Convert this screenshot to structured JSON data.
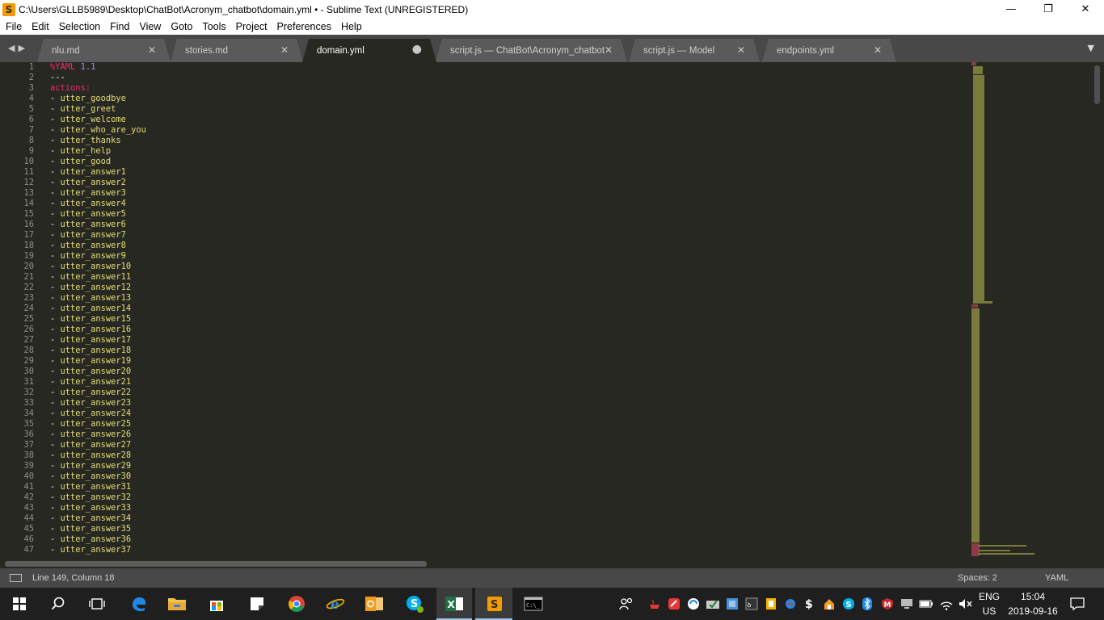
{
  "window": {
    "title": "C:\\Users\\GLLB5989\\Desktop\\ChatBot\\Acronym_chatbot\\domain.yml • - Sublime Text (UNREGISTERED)",
    "app_icon_glyph": "S",
    "minimize": "—",
    "maximize": "❐",
    "close": "✕"
  },
  "menu": [
    "File",
    "Edit",
    "Selection",
    "Find",
    "View",
    "Goto",
    "Tools",
    "Project",
    "Preferences",
    "Help"
  ],
  "tabs": [
    {
      "label": "nlu.md",
      "close": "✕"
    },
    {
      "label": "stories.md",
      "close": "✕"
    },
    {
      "label": "domain.yml",
      "close": "●",
      "active": true
    },
    {
      "label": "script.js — ChatBot\\Acronym_chatbot",
      "close": "✕"
    },
    {
      "label": "script.js — Model",
      "close": "✕"
    },
    {
      "label": "endpoints.yml",
      "close": "✕"
    }
  ],
  "tab_nav": {
    "prev": "◀",
    "next": "▶",
    "dropdown": "▼"
  },
  "editor": {
    "line_numbers": [
      "1",
      "2",
      "3",
      "4",
      "5",
      "6",
      "7",
      "8",
      "9",
      "10",
      "11",
      "12",
      "13",
      "14",
      "15",
      "16",
      "17",
      "18",
      "19",
      "20",
      "21",
      "22",
      "23",
      "24",
      "25",
      "26",
      "27",
      "28",
      "29",
      "30",
      "31",
      "32",
      "33",
      "34",
      "35",
      "36",
      "37",
      "38",
      "39",
      "40",
      "41",
      "42",
      "43",
      "44",
      "45",
      "46",
      "47"
    ],
    "header": {
      "pct": "%",
      "yaml": "YAML",
      "version": "1.1",
      "sep": "---",
      "actions": "actions:"
    },
    "items": [
      "utter_goodbye",
      "utter_greet",
      "utter_welcome",
      "utter_who_are_you",
      "utter_thanks",
      "utter_help",
      "utter_good",
      "utter_answer1",
      "utter_answer2",
      "utter_answer3",
      "utter_answer4",
      "utter_answer5",
      "utter_answer6",
      "utter_answer7",
      "utter_answer8",
      "utter_answer9",
      "utter_answer10",
      "utter_answer11",
      "utter_answer12",
      "utter_answer13",
      "utter_answer14",
      "utter_answer15",
      "utter_answer16",
      "utter_answer17",
      "utter_answer18",
      "utter_answer19",
      "utter_answer20",
      "utter_answer21",
      "utter_answer22",
      "utter_answer23",
      "utter_answer24",
      "utter_answer25",
      "utter_answer26",
      "utter_answer27",
      "utter_answer28",
      "utter_answer29",
      "utter_answer30",
      "utter_answer31",
      "utter_answer32",
      "utter_answer33",
      "utter_answer34",
      "utter_answer35",
      "utter_answer36",
      "utter_answer37"
    ],
    "dash": "-"
  },
  "status": {
    "position": "Line 149, Column 18",
    "spaces": "Spaces: 2",
    "syntax": "YAML"
  },
  "taskbar": {
    "language": "ENG",
    "region": "US",
    "time": "15:04",
    "date": "2019-09-16"
  },
  "colors": {
    "editor_bg": "#272822",
    "string": "#e6db74",
    "keyword": "#f92672",
    "number": "#ae81ff",
    "tabbar_bg": "#484848"
  }
}
